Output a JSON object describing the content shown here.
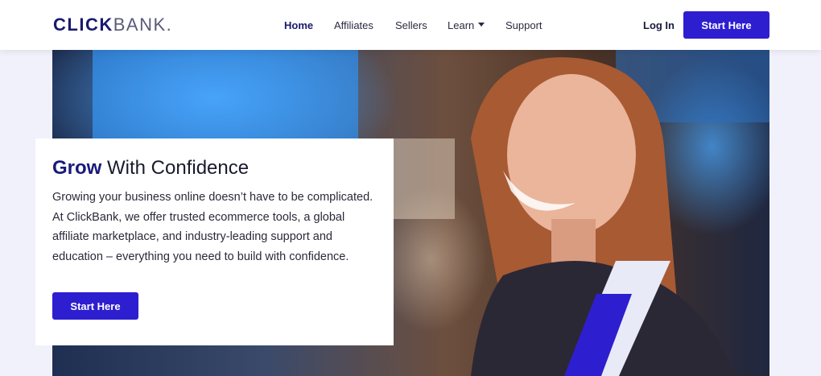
{
  "brand": {
    "logo_bold": "CLICK",
    "logo_light": "BANK.",
    "accent": "#2d1fd0",
    "navy": "#1a1a7a"
  },
  "nav": {
    "items": [
      {
        "label": "Home",
        "active": true
      },
      {
        "label": "Affiliates"
      },
      {
        "label": "Sellers"
      },
      {
        "label": "Learn",
        "icon": "chevron-down-icon"
      },
      {
        "label": "Support"
      }
    ],
    "login": "Log In",
    "cta": "Start Here"
  },
  "hero": {
    "title_bold": "Grow",
    "title_rest": " With Confidence",
    "body": "Growing your business online doesn’t have to be complicated. At ClickBank, we offer trusted ecommerce tools, a global affiliate marketplace, and industry-leading support and education – everything you need to build with confidence.",
    "cta": "Start Here"
  }
}
